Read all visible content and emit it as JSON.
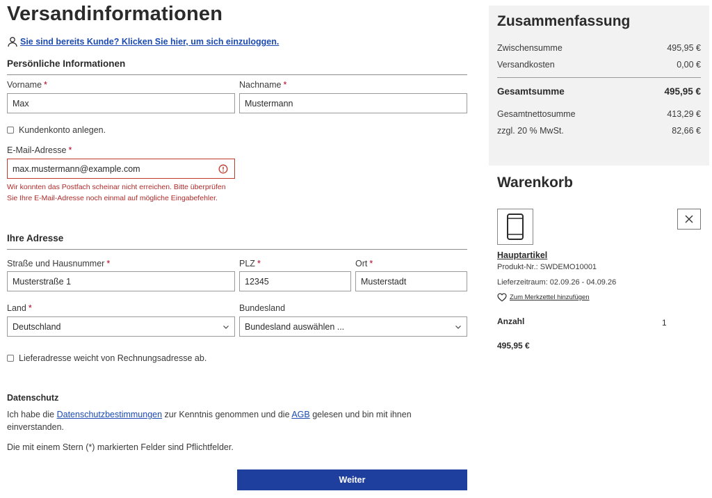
{
  "page_title": "Versandinformationen",
  "login_link": "Sie sind bereits Kunde? Klicken Sie hier, um sich einzuloggen.",
  "personal": {
    "heading": "Persönliche Informationen",
    "firstname_label": "Vorname",
    "firstname_value": "Max",
    "lastname_label": "Nachname",
    "lastname_value": "Mustermann",
    "account_checkbox": "Kundenkonto anlegen.",
    "email_label": "E-Mail-Adresse",
    "email_value": "max.mustermann@example.com",
    "email_error": "Wir konnten das Postfach scheinar nicht erreichen. Bitte überprüfen Sie Ihre E-Mail-Adresse noch einmal auf mögliche Eingabefehler."
  },
  "address": {
    "heading": "Ihre Adresse",
    "street_label": "Straße und Hausnummer",
    "street_value": "Musterstraße 1",
    "zip_label": "PLZ",
    "zip_value": "12345",
    "city_label": "Ort",
    "city_value": "Musterstadt",
    "country_label": "Land",
    "country_value": "Deutschland",
    "state_label": "Bundesland",
    "state_value": "Bundesland auswählen ...",
    "shipping_checkbox": "Lieferadresse weicht von Rechnungsadresse ab."
  },
  "required_marker": "*",
  "privacy": {
    "heading": "Datenschutz",
    "text_1": "Ich habe die ",
    "link_privacy": "Datenschutzbestimmungen",
    "text_2": " zur Kenntnis genommen und die ",
    "link_terms": "AGB",
    "text_3": " gelesen und bin mit ihnen einverstanden.",
    "required_note": "Die mit einem Stern (*) markierten Felder sind Pflichtfelder."
  },
  "submit_label": "Weiter",
  "summary": {
    "title": "Zusammenfassung",
    "subtotal_label": "Zwischensumme",
    "subtotal_value": "495,95 €",
    "shipping_label": "Versandkosten",
    "shipping_value": "0,00 €",
    "total_label": "Gesamtsumme",
    "total_value": "495,95 €",
    "net_label": "Gesamtnettosumme",
    "net_value": "413,29 €",
    "tax_label": "zzgl. 20 % MwSt.",
    "tax_value": "82,66 €"
  },
  "cart": {
    "title": "Warenkorb",
    "product_name": "Hauptartikel",
    "product_number": "Produkt-Nr.: SWDEMO10001",
    "delivery": "Lieferzeitraum: 02.09.26 - 04.09.26",
    "wishlist_label": "Zum Merkzettel hinzufügen",
    "quantity_label": "Anzahl",
    "quantity_value": "1",
    "price": "495,95 €"
  },
  "colors": {
    "accent": "#1f3f9e",
    "link": "#1c4bb0",
    "error": "#b02a2a",
    "summary_bg": "#f2f2f2"
  }
}
